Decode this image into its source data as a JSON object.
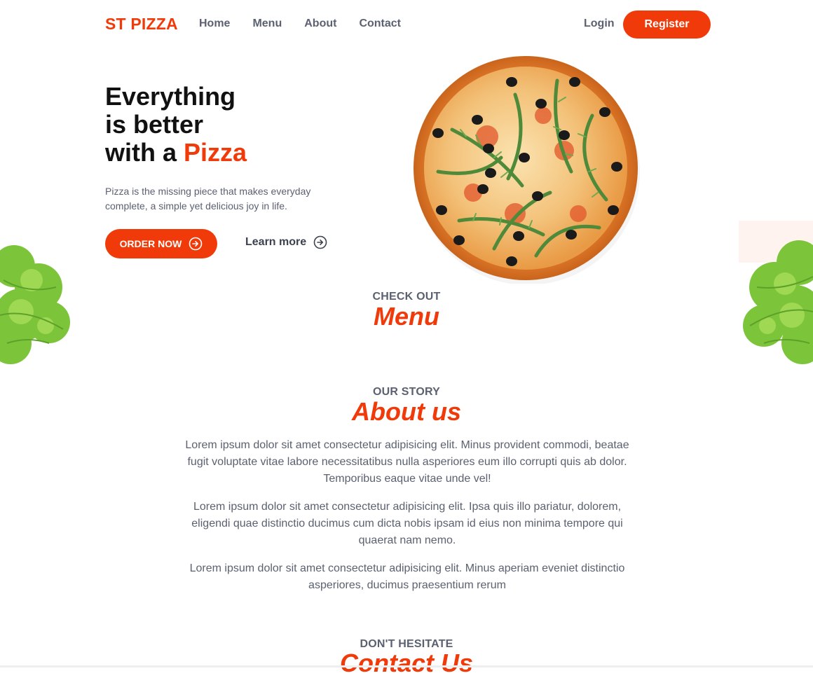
{
  "nav": {
    "brand": "ST PIZZA",
    "links": [
      "Home",
      "Menu",
      "About",
      "Contact"
    ],
    "login": "Login",
    "register": "Register"
  },
  "hero": {
    "title_line1": "Everything",
    "title_line2": "is better",
    "title_line3_prefix": "with a ",
    "title_line3_accent": "Pizza",
    "description": "Pizza is the missing piece that makes everyday complete, a simple yet delicious joy in life.",
    "order_button": "ORDER NOW",
    "learn_more": "Learn more"
  },
  "menu_section": {
    "eyebrow": "CHECK OUT",
    "title": "Menu"
  },
  "about_section": {
    "eyebrow": "OUR STORY",
    "title": "About us",
    "paragraphs": [
      "Lorem ipsum dolor sit amet consectetur adipisicing elit. Minus provident commodi, beatae fugit voluptate vitae labore necessitatibus nulla asperiores eum illo corrupti quis ab dolor. Temporibus eaque vitae unde vel!",
      "Lorem ipsum dolor sit amet consectetur adipisicing elit. Ipsa quis illo pariatur, dolorem, eligendi quae distinctio ducimus cum dicta nobis ipsam id eius non minima tempore qui quaerat nam nemo.",
      "Lorem ipsum dolor sit amet consectetur adipisicing elit. Minus aperiam eveniet distinctio asperiores, ducimus praesentium rerum"
    ]
  },
  "contact_section": {
    "eyebrow": "DON'T HESITATE",
    "title": "Contact Us"
  },
  "colors": {
    "accent": "#f13a0a",
    "text_muted": "#5b6170",
    "heading": "#111111"
  },
  "icons": {
    "order": "circle-arrow-right-icon",
    "learn_more": "circle-arrow-right-icon"
  }
}
